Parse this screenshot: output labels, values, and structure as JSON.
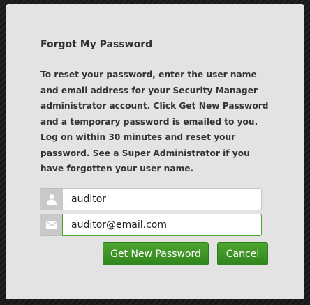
{
  "dialog": {
    "title": "Forgot My Password",
    "description": "To reset your password, enter the user name and email address for your Security Manager administrator account. Click Get New Password and a temporary password is emailed to you. Log on within 30 minutes and reset your password. See a Super Administrator if you have forgotten your user name."
  },
  "form": {
    "username": {
      "value": "auditor",
      "icon": "user-icon"
    },
    "email": {
      "value": "auditor@email.com",
      "icon": "envelope-icon"
    }
  },
  "buttons": {
    "submit_label": "Get New Password",
    "cancel_label": "Cancel"
  },
  "colors": {
    "accent": "#3a9626",
    "dialog_background": "#e3e3e3",
    "text": "#333333"
  }
}
